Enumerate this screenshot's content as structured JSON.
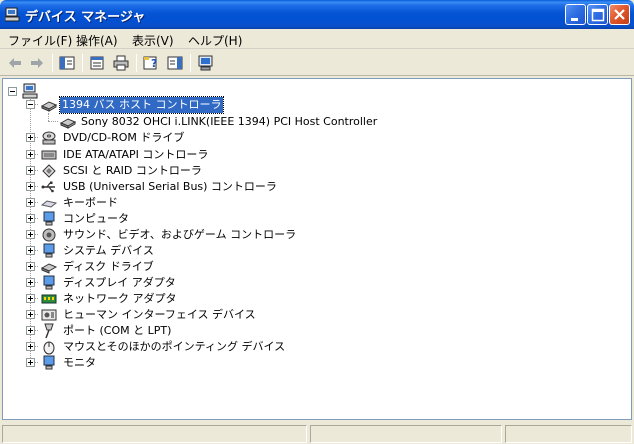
{
  "window": {
    "title": "デバイス マネージャ",
    "controls": {
      "minimize": "minimize",
      "maximize": "maximize",
      "close": "close"
    }
  },
  "menu": [
    {
      "label": "ファイル(F)"
    },
    {
      "label": "操作(A)"
    },
    {
      "label": "表示(V)"
    },
    {
      "label": "ヘルプ(H)"
    }
  ],
  "toolbar": {
    "icons": [
      "back-arrow-icon",
      "forward-arrow-icon",
      "show-hide-tree-icon",
      "properties-icon",
      "print-icon",
      "help-icon",
      "show-hide-action-pane-icon",
      "scan-hardware-icon"
    ]
  },
  "tree": {
    "root": {
      "icon": "computer-icon"
    },
    "items": [
      {
        "label": "1394 バス ホスト コントローラ",
        "expanded": true,
        "selected": true,
        "children": [
          {
            "label": "Sony 8032 OHCI i.LINK(IEEE 1394) PCI Host Controller"
          }
        ]
      },
      {
        "label": "DVD/CD-ROM ドライブ"
      },
      {
        "label": "IDE ATA/ATAPI コントローラ"
      },
      {
        "label": "SCSI と RAID コントローラ"
      },
      {
        "label": "USB (Universal Serial Bus) コントローラ"
      },
      {
        "label": "キーボード"
      },
      {
        "label": "コンピュータ"
      },
      {
        "label": "サウンド、ビデオ、およびゲーム コントローラ"
      },
      {
        "label": "システム デバイス"
      },
      {
        "label": "ディスク ドライブ"
      },
      {
        "label": "ディスプレイ アダプタ"
      },
      {
        "label": "ネットワーク アダプタ"
      },
      {
        "label": "ヒューマン インターフェイス デバイス"
      },
      {
        "label": "ポート (COM と LPT)"
      },
      {
        "label": "マウスとそのほかのポインティング デバイス"
      },
      {
        "label": "モニタ"
      }
    ]
  },
  "colors": {
    "titlebar": "#0454d6",
    "selection": "#316ac5",
    "chrome": "#ece9d8"
  }
}
